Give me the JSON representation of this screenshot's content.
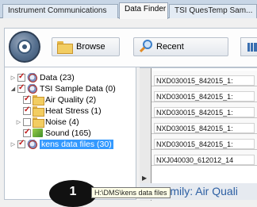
{
  "tabs": [
    {
      "label": "Instrument Communications"
    },
    {
      "label": "Data Finder",
      "active": true
    },
    {
      "label": "TSI QuesTemp Sam..."
    }
  ],
  "toolbar": {
    "browse_label": "Browse",
    "recent_label": "Recent"
  },
  "tree": {
    "items": [
      {
        "label": "Data (23)",
        "checked": true,
        "icon": "database-icon"
      },
      {
        "label": "TSI Sample Data (0)",
        "checked": true,
        "icon": "database-icon"
      },
      {
        "label": "Air Quality (2)",
        "checked": true,
        "icon": "folder-icon"
      },
      {
        "label": "Heat Stress (1)",
        "checked": true,
        "icon": "folder-icon"
      },
      {
        "label": "Noise (4)",
        "checked": false,
        "icon": "folder-icon"
      },
      {
        "label": "Sound (165)",
        "checked": true,
        "icon": "sound-folder-icon"
      },
      {
        "label": "kens data files (30)",
        "checked": true,
        "icon": "database-icon",
        "selected": true
      }
    ]
  },
  "callout": {
    "number": "1",
    "tooltip": "H:\\DMS\\kens data files"
  },
  "grid": {
    "rows": [
      "NXD030015_842015_1:",
      "NXD030015_842015_1:",
      "NXD030015_842015_1:",
      "NXD030015_842015_1:",
      "NXD030015_842015_1:",
      "NXJ040030_612012_14"
    ],
    "family_label": "Family: Air Quali"
  },
  "colors": {
    "selection": "#3399ff",
    "check": "#c01818",
    "family_text": "#2c5fa3"
  }
}
